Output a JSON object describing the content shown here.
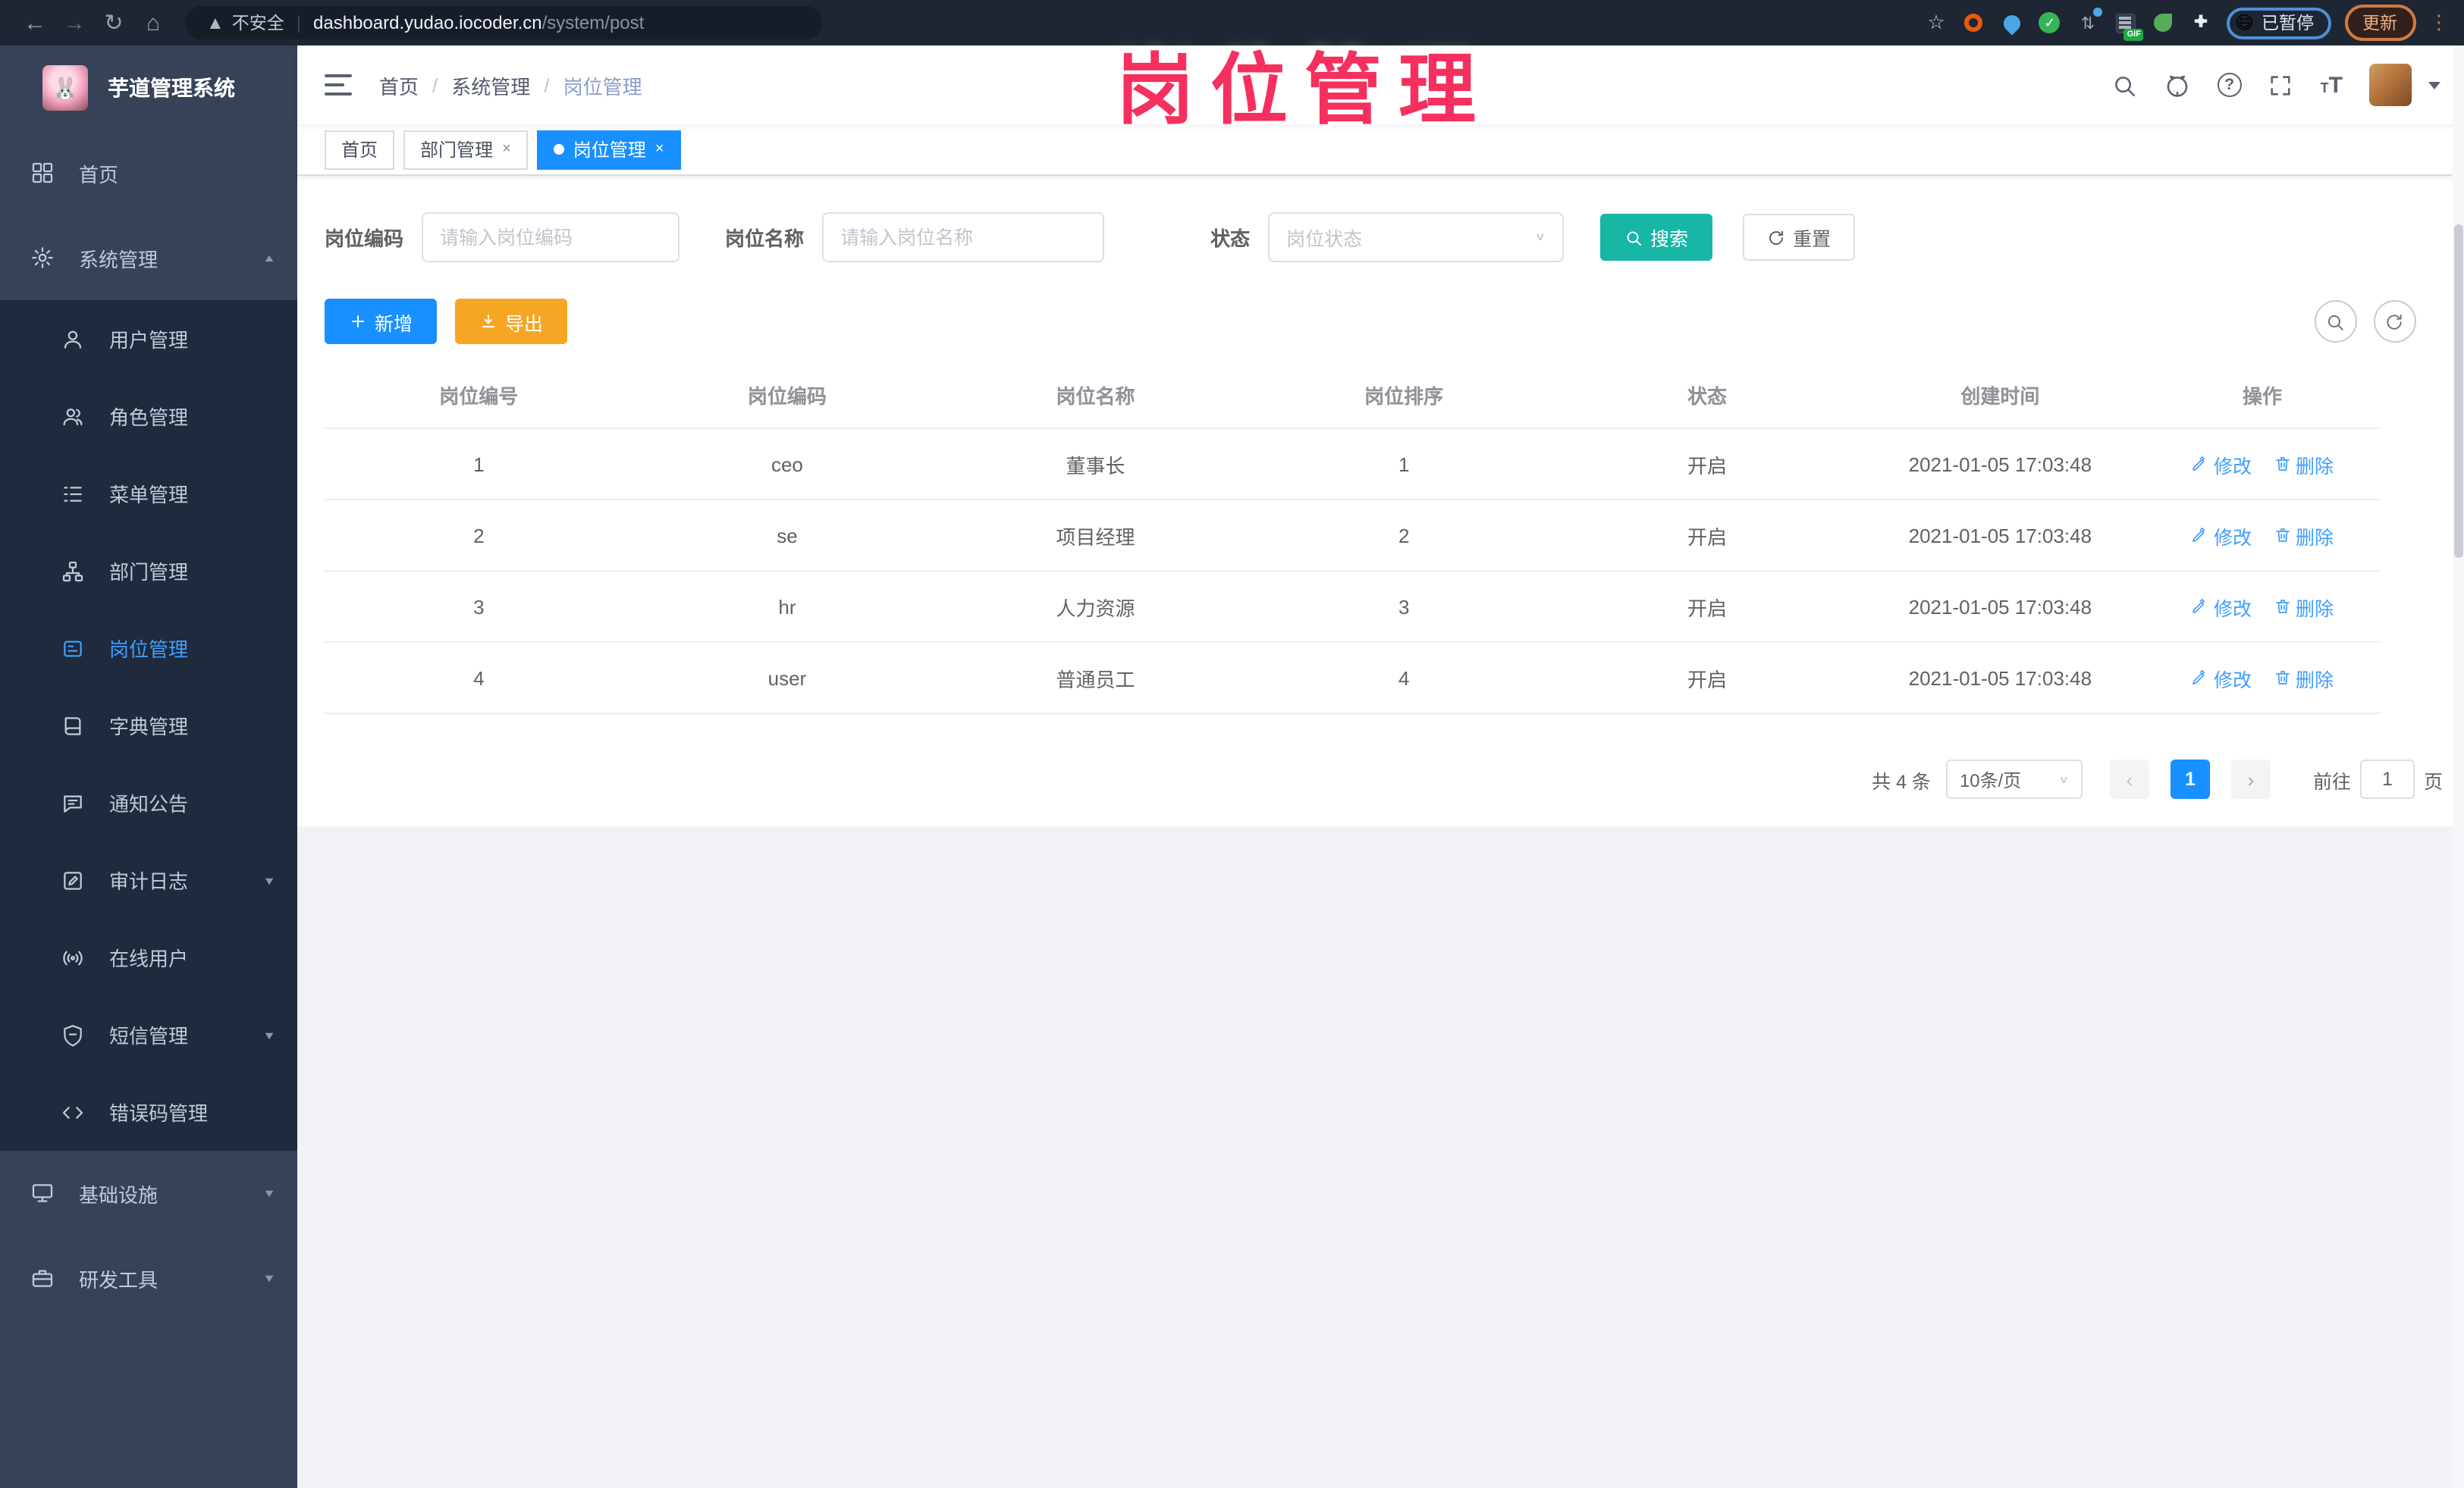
{
  "browser": {
    "security_text": "不安全",
    "url_host": "dashboard.yudao.iocoder.cn",
    "url_path": "/system/post",
    "paused_emoji": "😄",
    "paused_label": "已暂停",
    "update_label": "更新",
    "gif_badge": "GIF"
  },
  "overlay": {
    "text": "岗位管理"
  },
  "sidebar": {
    "app_title": "芋道管理系统",
    "items": [
      {
        "label": "首页",
        "icon": "dashboard-icon"
      },
      {
        "label": "系统管理",
        "icon": "gear-icon",
        "chevron": "up"
      },
      {
        "label": "用户管理",
        "icon": "user-icon"
      },
      {
        "label": "角色管理",
        "icon": "role-icon"
      },
      {
        "label": "菜单管理",
        "icon": "menu-list-icon"
      },
      {
        "label": "部门管理",
        "icon": "dept-tree-icon"
      },
      {
        "label": "岗位管理",
        "icon": "post-badge-icon",
        "active": true
      },
      {
        "label": "字典管理",
        "icon": "dict-book-icon"
      },
      {
        "label": "通知公告",
        "icon": "notice-bubble-icon"
      },
      {
        "label": "审计日志",
        "icon": "audit-log-icon",
        "chevron": "down"
      },
      {
        "label": "在线用户",
        "icon": "online-signal-icon"
      },
      {
        "label": "短信管理",
        "icon": "sms-shield-icon",
        "chevron": "down"
      },
      {
        "label": "错误码管理",
        "icon": "error-code-icon"
      },
      {
        "label": "基础设施",
        "icon": "infra-monitor-icon",
        "chevron": "down"
      },
      {
        "label": "研发工具",
        "icon": "dev-tools-icon",
        "chevron": "down"
      }
    ]
  },
  "header": {
    "breadcrumb": [
      "首页",
      "系统管理",
      "岗位管理"
    ],
    "separator": "/"
  },
  "tabs": {
    "items": [
      {
        "label": "首页"
      },
      {
        "label": "部门管理",
        "close": "×"
      },
      {
        "label": "岗位管理",
        "close": "×",
        "active": true
      }
    ]
  },
  "filters": {
    "post_code_label": "岗位编码",
    "post_code_placeholder": "请输入岗位编码",
    "post_name_label": "岗位名称",
    "post_name_placeholder": "请输入岗位名称",
    "status_label": "状态",
    "status_placeholder": "岗位状态",
    "search_label": "搜索",
    "reset_label": "重置"
  },
  "toolbar": {
    "add_label": "新增",
    "export_label": "导出"
  },
  "table": {
    "columns": [
      "岗位编号",
      "岗位编码",
      "岗位名称",
      "岗位排序",
      "状态",
      "创建时间",
      "操作"
    ],
    "edit_label": "修改",
    "delete_label": "删除",
    "rows": [
      {
        "id": "1",
        "code": "ceo",
        "name": "董事长",
        "sort": "1",
        "status": "开启",
        "created": "2021-01-05 17:03:48"
      },
      {
        "id": "2",
        "code": "se",
        "name": "项目经理",
        "sort": "2",
        "status": "开启",
        "created": "2021-01-05 17:03:48"
      },
      {
        "id": "3",
        "code": "hr",
        "name": "人力资源",
        "sort": "3",
        "status": "开启",
        "created": "2021-01-05 17:03:48"
      },
      {
        "id": "4",
        "code": "user",
        "name": "普通员工",
        "sort": "4",
        "status": "开启",
        "created": "2021-01-05 17:03:48"
      }
    ]
  },
  "pagination": {
    "total_text": "共 4 条",
    "page_size": "10条/页",
    "prev": "‹",
    "current_page": "1",
    "next": "›",
    "goto_label": "前往",
    "goto_value": "1",
    "page_unit": "页"
  },
  "colors": {
    "accent_blue": "#1890ff",
    "link_blue": "#409eff",
    "search_teal": "#18b6a4",
    "export_orange": "#f5a623",
    "overlay_pink": "#f5305e",
    "sidebar_bg": "#364258",
    "submenu_bg": "#1f2a3c"
  }
}
